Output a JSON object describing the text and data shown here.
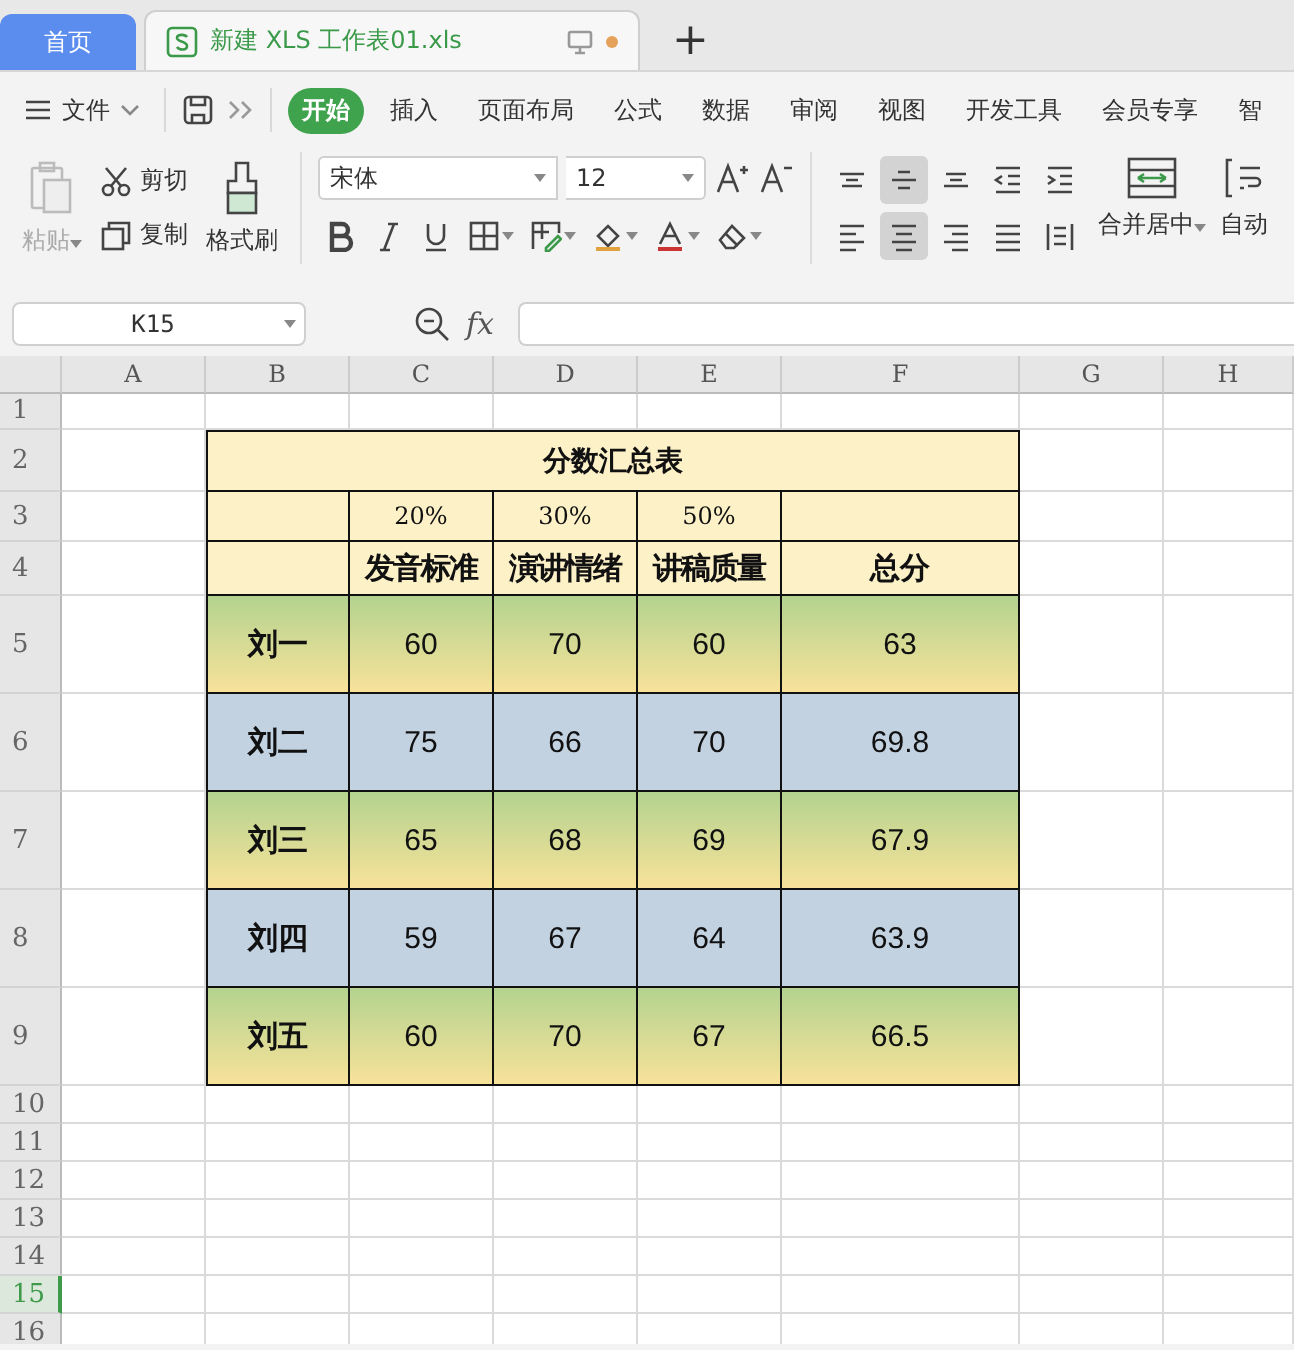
{
  "window_tabs": [
    {
      "label": "首页",
      "kind": "home",
      "selected": false
    },
    {
      "label": "新建 XLS 工作表01.xls",
      "kind": "doc",
      "selected": true,
      "modified": true
    }
  ],
  "new_tab": "+",
  "menu": {
    "file": "文件",
    "tabs": [
      {
        "label": "开始",
        "selected": true
      },
      {
        "label": "插入",
        "selected": false
      },
      {
        "label": "页面布局",
        "selected": false
      },
      {
        "label": "公式",
        "selected": false
      },
      {
        "label": "数据",
        "selected": false
      },
      {
        "label": "审阅",
        "selected": false
      },
      {
        "label": "视图",
        "selected": false
      },
      {
        "label": "开发工具",
        "selected": false
      },
      {
        "label": "会员专享",
        "selected": false
      },
      {
        "label": "智",
        "selected": false
      }
    ]
  },
  "ribbon": {
    "paste": {
      "label": "粘贴",
      "disabled": true
    },
    "cut": "剪切",
    "copy": "复制",
    "painter": "格式刷",
    "font_name": "宋体",
    "font_size": "12",
    "format_tools": [
      {
        "kind": "bold"
      },
      {
        "kind": "italic"
      },
      {
        "kind": "underline"
      },
      {
        "kind": "border"
      },
      {
        "kind": "cellfmt"
      },
      {
        "kind": "fill"
      },
      {
        "kind": "fontcolor"
      },
      {
        "kind": "eraser"
      }
    ],
    "align_top": [
      {
        "kind": "top",
        "selected": false
      },
      {
        "kind": "middle",
        "selected": true
      },
      {
        "kind": "bottom",
        "selected": false
      },
      {
        "kind": "outdent",
        "selected": false
      },
      {
        "kind": "indent",
        "selected": false
      }
    ],
    "align_bottom": [
      {
        "kind": "left",
        "selected": false
      },
      {
        "kind": "center",
        "selected": true
      },
      {
        "kind": "right",
        "selected": false
      },
      {
        "kind": "justify",
        "selected": false
      },
      {
        "kind": "distribute",
        "selected": false
      }
    ],
    "merge": "合并居中",
    "wrap": "自动"
  },
  "formula_bar": {
    "name_box": "K15",
    "fx": "fx"
  },
  "sheet": {
    "columns": [
      "A",
      "B",
      "C",
      "D",
      "E",
      "F",
      "G",
      "H"
    ],
    "rows": [
      {
        "label": "1",
        "selected": false
      },
      {
        "label": "2",
        "selected": false
      },
      {
        "label": "3",
        "selected": false
      },
      {
        "label": "4",
        "selected": false
      },
      {
        "label": "5",
        "selected": false
      },
      {
        "label": "6",
        "selected": false
      },
      {
        "label": "7",
        "selected": false
      },
      {
        "label": "8",
        "selected": false
      },
      {
        "label": "9",
        "selected": false
      },
      {
        "label": "10",
        "selected": false
      },
      {
        "label": "11",
        "selected": false
      },
      {
        "label": "12",
        "selected": false
      },
      {
        "label": "13",
        "selected": false
      },
      {
        "label": "14",
        "selected": false
      },
      {
        "label": "15",
        "selected": true
      },
      {
        "label": "16",
        "selected": false
      }
    ],
    "score_table": {
      "title": "分数汇总表",
      "weights": [
        "20%",
        "30%",
        "50%"
      ],
      "headers": [
        "发音标准",
        "演讲情绪",
        "讲稿质量",
        "总分"
      ],
      "rows": [
        {
          "name": "刘一",
          "kind": "green",
          "scores": [
            "60",
            "70",
            "60"
          ],
          "total": "63"
        },
        {
          "name": "刘二",
          "kind": "blue",
          "scores": [
            "75",
            "66",
            "70"
          ],
          "total": "69.8"
        },
        {
          "name": "刘三",
          "kind": "green",
          "scores": [
            "65",
            "68",
            "69"
          ],
          "total": "67.9"
        },
        {
          "name": "刘四",
          "kind": "blue",
          "scores": [
            "59",
            "67",
            "64"
          ],
          "total": "63.9"
        },
        {
          "name": "刘五",
          "kind": "green",
          "scores": [
            "60",
            "70",
            "67"
          ],
          "total": "66.5"
        }
      ]
    }
  }
}
